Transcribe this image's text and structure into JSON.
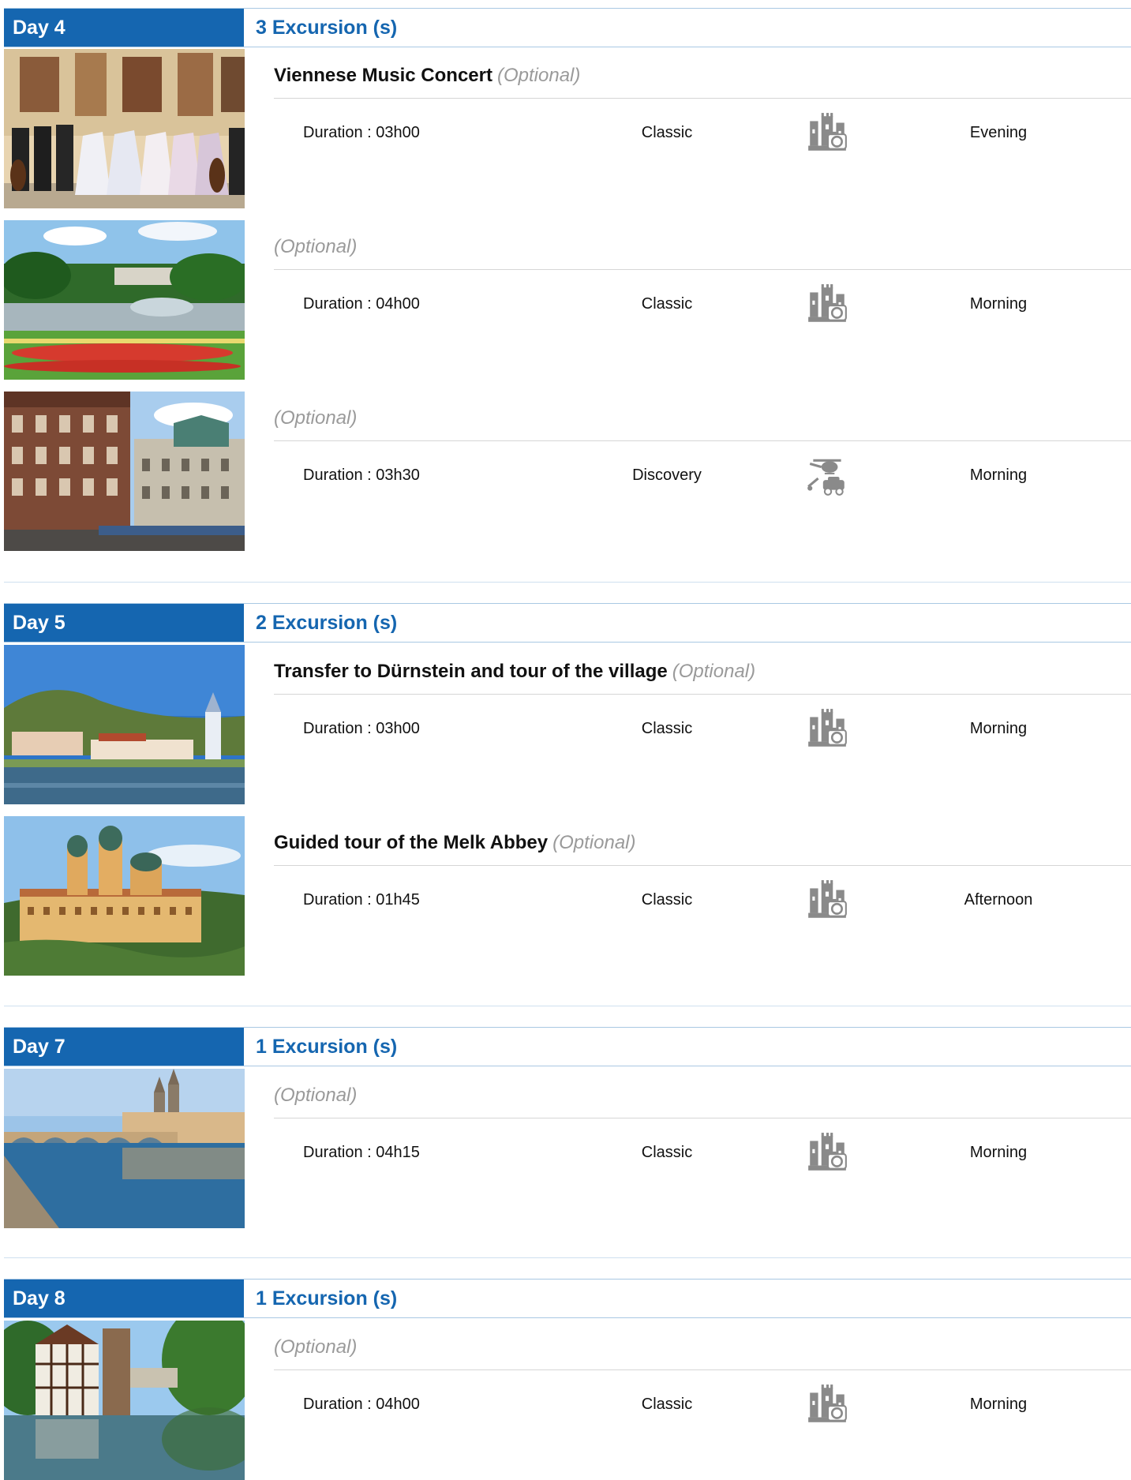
{
  "days": [
    {
      "label": "Day 4",
      "count": "3 Excursion (s)",
      "excursions": [
        {
          "name": "Viennese Music Concert",
          "optional": "(Optional)",
          "duration": "Duration : 03h00",
          "type": "Classic",
          "icon": "castle-camera-icon",
          "time": "Evening",
          "photo": "concert-hall-photo"
        },
        {
          "name": "",
          "optional": "(Optional)",
          "duration": "Duration : 04h00",
          "type": "Classic",
          "icon": "castle-camera-icon",
          "time": "Morning",
          "photo": "palace-garden-photo"
        },
        {
          "name": "",
          "optional": "(Optional)",
          "duration": "Duration : 03h30",
          "type": "Discovery",
          "icon": "helicopter-car-icon",
          "time": "Morning",
          "photo": "city-street-photo"
        }
      ]
    },
    {
      "label": "Day 5",
      "count": "2 Excursion (s)",
      "excursions": [
        {
          "name": "Transfer to Dürnstein and tour of the village",
          "optional": "(Optional)",
          "duration": "Duration : 03h00",
          "type": "Classic",
          "icon": "castle-camera-icon",
          "time": "Morning",
          "photo": "riverside-village-photo"
        },
        {
          "name": "Guided tour of the Melk Abbey",
          "optional": "(Optional)",
          "duration": "Duration : 01h45",
          "type": "Classic",
          "icon": "castle-camera-icon",
          "time": "Afternoon",
          "photo": "abbey-photo"
        }
      ]
    },
    {
      "label": "Day 7",
      "count": "1 Excursion (s)",
      "excursions": [
        {
          "name": "",
          "optional": "(Optional)",
          "duration": "Duration : 04h15",
          "type": "Classic",
          "icon": "castle-camera-icon",
          "time": "Morning",
          "photo": "stone-bridge-photo"
        }
      ]
    },
    {
      "label": "Day 8",
      "count": "1 Excursion (s)",
      "excursions": [
        {
          "name": "",
          "optional": "(Optional)",
          "duration": "Duration : 04h00",
          "type": "Classic",
          "icon": "castle-camera-icon",
          "time": "Morning",
          "photo": "half-timbered-house-photo"
        }
      ]
    }
  ],
  "colors": {
    "day_bar": "#1566b0",
    "count_text": "#1566b0",
    "optional_text": "#9a9a9a"
  }
}
